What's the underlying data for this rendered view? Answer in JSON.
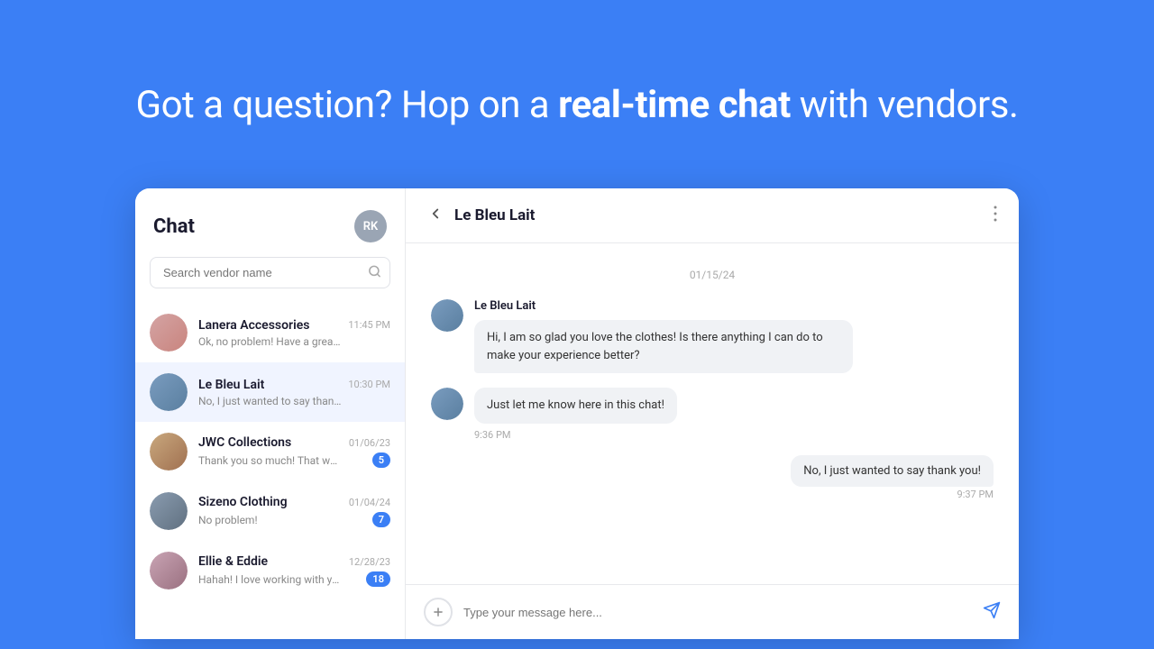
{
  "hero": {
    "title_prefix": "Got a question? Hop on a",
    "title_bold": "real-time chat",
    "title_suffix": "with vendors."
  },
  "header": {
    "title": "Chat",
    "avatar_initials": "RK"
  },
  "search": {
    "placeholder": "Search vendor name"
  },
  "chat_list": [
    {
      "id": "lanera",
      "name": "Lanera Accessories",
      "preview": "Ok, no problem! Have a great day!",
      "time": "11:45 PM",
      "badge": null,
      "avatar_class": "av-lanera"
    },
    {
      "id": "lebleu",
      "name": "Le Bleu Lait",
      "preview": "No, I just wanted to say thank you!",
      "time": "10:30 PM",
      "badge": null,
      "avatar_class": "av-lebleu",
      "active": true
    },
    {
      "id": "jwc",
      "name": "JWC Collections",
      "preview": "Thank you so much! That was very helpful!",
      "time": "01/06/23",
      "badge": "5",
      "avatar_class": "av-jwc"
    },
    {
      "id": "sizeno",
      "name": "Sizeno Clothing",
      "preview": "No problem!",
      "time": "01/04/24",
      "badge": "7",
      "avatar_class": "av-sizeno"
    },
    {
      "id": "ellie",
      "name": "Ellie & Eddie",
      "preview": "Hahah! I love working with you Sasha!",
      "time": "12/28/23",
      "badge": "18",
      "avatar_class": "av-ellie"
    }
  ],
  "chat_detail": {
    "vendor_name": "Le Bleu Lait",
    "date_divider": "01/15/24",
    "messages": [
      {
        "id": "m1",
        "sender": "Le Bleu Lait",
        "side": "left",
        "bubbles": [
          "Hi, I am so glad you love the clothes! Is there anything I can do to make your experience better?"
        ],
        "time": null
      },
      {
        "id": "m2",
        "sender": null,
        "side": "left",
        "bubbles": [
          "Just let me know here in this chat!"
        ],
        "time": "9:36 PM"
      },
      {
        "id": "m3",
        "sender": null,
        "side": "right",
        "bubbles": [
          "No, I just wanted to say thank you!"
        ],
        "time": "9:37 PM"
      }
    ]
  },
  "input": {
    "placeholder": "Type your message here..."
  }
}
